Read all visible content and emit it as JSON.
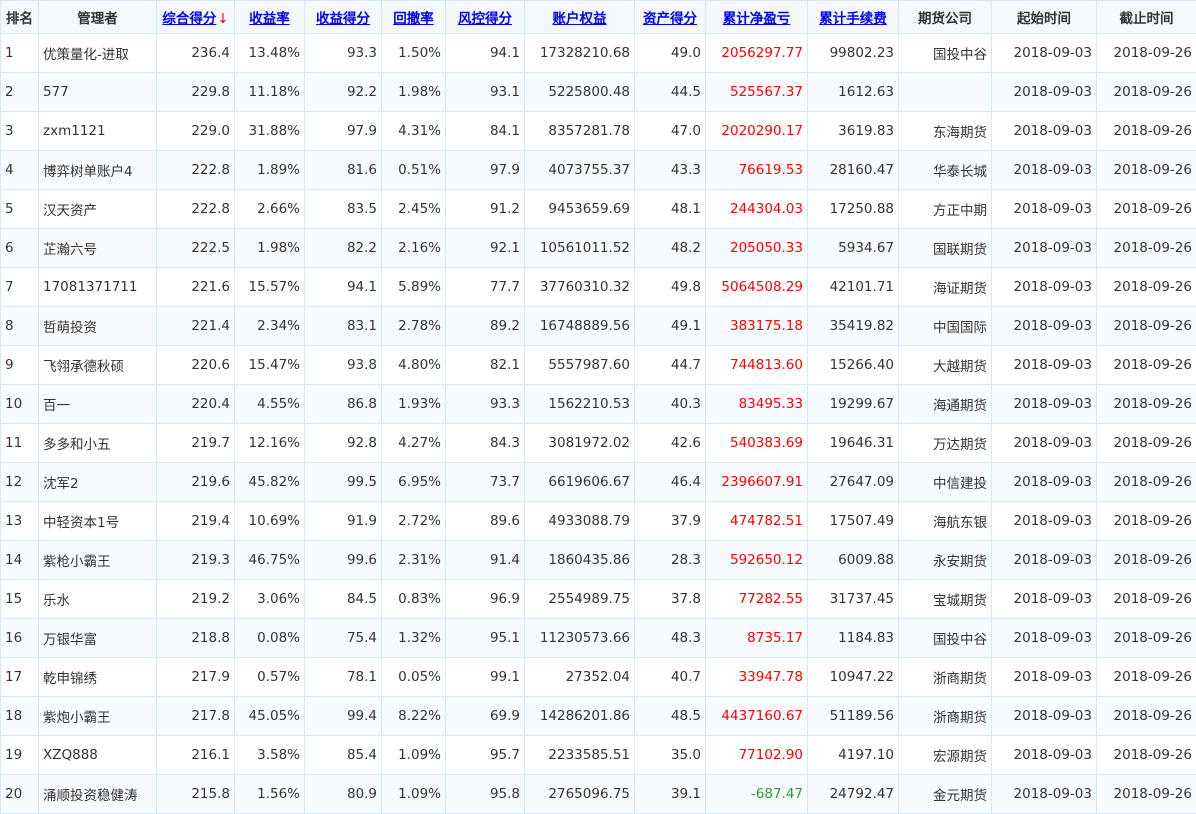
{
  "headers": [
    {
      "key": "rank",
      "label": "排名",
      "sortable": false
    },
    {
      "key": "manager",
      "label": "管理者",
      "sortable": false
    },
    {
      "key": "total_score",
      "label": "综合得分",
      "sortable": true,
      "sorted": "desc"
    },
    {
      "key": "return_rate",
      "label": "收益率",
      "sortable": true
    },
    {
      "key": "return_score",
      "label": "收益得分",
      "sortable": true
    },
    {
      "key": "drawdown",
      "label": "回撤率",
      "sortable": true
    },
    {
      "key": "risk_score",
      "label": "风控得分",
      "sortable": true
    },
    {
      "key": "equity",
      "label": "账户权益",
      "sortable": true
    },
    {
      "key": "asset_score",
      "label": "资产得分",
      "sortable": true
    },
    {
      "key": "net_pnl",
      "label": "累计净盈亏",
      "sortable": true
    },
    {
      "key": "fees",
      "label": "累计手续费",
      "sortable": true
    },
    {
      "key": "broker",
      "label": "期货公司",
      "sortable": false
    },
    {
      "key": "start",
      "label": "起始时间",
      "sortable": false
    },
    {
      "key": "end",
      "label": "截止时间",
      "sortable": false
    }
  ],
  "sort_arrow": "↓",
  "colors": {
    "profit": "#ff0000",
    "loss": "#339933",
    "link": "#0000ee",
    "border": "#d6e7f7"
  },
  "rows": [
    {
      "rank": "1",
      "manager": "优策量化-进取",
      "total_score": "236.4",
      "return_rate": "13.48%",
      "return_score": "93.3",
      "drawdown": "1.50%",
      "risk_score": "94.1",
      "equity": "17328210.68",
      "asset_score": "49.0",
      "net_pnl": "2056297.77",
      "fees": "99802.23",
      "broker": "国投中谷",
      "start": "2018-09-03",
      "end": "2018-09-26"
    },
    {
      "rank": "2",
      "manager": "577",
      "total_score": "229.8",
      "return_rate": "11.18%",
      "return_score": "92.2",
      "drawdown": "1.98%",
      "risk_score": "93.1",
      "equity": "5225800.48",
      "asset_score": "44.5",
      "net_pnl": "525567.37",
      "fees": "1612.63",
      "broker": "",
      "start": "2018-09-03",
      "end": "2018-09-26"
    },
    {
      "rank": "3",
      "manager": "zxm1121",
      "total_score": "229.0",
      "return_rate": "31.88%",
      "return_score": "97.9",
      "drawdown": "4.31%",
      "risk_score": "84.1",
      "equity": "8357281.78",
      "asset_score": "47.0",
      "net_pnl": "2020290.17",
      "fees": "3619.83",
      "broker": "东海期货",
      "start": "2018-09-03",
      "end": "2018-09-26"
    },
    {
      "rank": "4",
      "manager": "博弈树单账户4",
      "total_score": "222.8",
      "return_rate": "1.89%",
      "return_score": "81.6",
      "drawdown": "0.51%",
      "risk_score": "97.9",
      "equity": "4073755.37",
      "asset_score": "43.3",
      "net_pnl": "76619.53",
      "fees": "28160.47",
      "broker": "华泰长城",
      "start": "2018-09-03",
      "end": "2018-09-26"
    },
    {
      "rank": "5",
      "manager": "汉天资产",
      "total_score": "222.8",
      "return_rate": "2.66%",
      "return_score": "83.5",
      "drawdown": "2.45%",
      "risk_score": "91.2",
      "equity": "9453659.69",
      "asset_score": "48.1",
      "net_pnl": "244304.03",
      "fees": "17250.88",
      "broker": "方正中期",
      "start": "2018-09-03",
      "end": "2018-09-26"
    },
    {
      "rank": "6",
      "manager": "芷瀚六号",
      "total_score": "222.5",
      "return_rate": "1.98%",
      "return_score": "82.2",
      "drawdown": "2.16%",
      "risk_score": "92.1",
      "equity": "10561011.52",
      "asset_score": "48.2",
      "net_pnl": "205050.33",
      "fees": "5934.67",
      "broker": "国联期货",
      "start": "2018-09-03",
      "end": "2018-09-26"
    },
    {
      "rank": "7",
      "manager": "17081371711",
      "total_score": "221.6",
      "return_rate": "15.57%",
      "return_score": "94.1",
      "drawdown": "5.89%",
      "risk_score": "77.7",
      "equity": "37760310.32",
      "asset_score": "49.8",
      "net_pnl": "5064508.29",
      "fees": "42101.71",
      "broker": "海证期货",
      "start": "2018-09-03",
      "end": "2018-09-26"
    },
    {
      "rank": "8",
      "manager": "哲萌投资",
      "total_score": "221.4",
      "return_rate": "2.34%",
      "return_score": "83.1",
      "drawdown": "2.78%",
      "risk_score": "89.2",
      "equity": "16748889.56",
      "asset_score": "49.1",
      "net_pnl": "383175.18",
      "fees": "35419.82",
      "broker": "中国国际",
      "start": "2018-09-03",
      "end": "2018-09-26"
    },
    {
      "rank": "9",
      "manager": "飞翎承德秋硕",
      "total_score": "220.6",
      "return_rate": "15.47%",
      "return_score": "93.8",
      "drawdown": "4.80%",
      "risk_score": "82.1",
      "equity": "5557987.60",
      "asset_score": "44.7",
      "net_pnl": "744813.60",
      "fees": "15266.40",
      "broker": "大越期货",
      "start": "2018-09-03",
      "end": "2018-09-26"
    },
    {
      "rank": "10",
      "manager": "百一",
      "total_score": "220.4",
      "return_rate": "4.55%",
      "return_score": "86.8",
      "drawdown": "1.93%",
      "risk_score": "93.3",
      "equity": "1562210.53",
      "asset_score": "40.3",
      "net_pnl": "83495.33",
      "fees": "19299.67",
      "broker": "海通期货",
      "start": "2018-09-03",
      "end": "2018-09-26"
    },
    {
      "rank": "11",
      "manager": "多多和小五",
      "total_score": "219.7",
      "return_rate": "12.16%",
      "return_score": "92.8",
      "drawdown": "4.27%",
      "risk_score": "84.3",
      "equity": "3081972.02",
      "asset_score": "42.6",
      "net_pnl": "540383.69",
      "fees": "19646.31",
      "broker": "万达期货",
      "start": "2018-09-03",
      "end": "2018-09-26"
    },
    {
      "rank": "12",
      "manager": "沈军2",
      "total_score": "219.6",
      "return_rate": "45.82%",
      "return_score": "99.5",
      "drawdown": "6.95%",
      "risk_score": "73.7",
      "equity": "6619606.67",
      "asset_score": "46.4",
      "net_pnl": "2396607.91",
      "fees": "27647.09",
      "broker": "中信建投",
      "start": "2018-09-03",
      "end": "2018-09-26"
    },
    {
      "rank": "13",
      "manager": "中轻资本1号",
      "total_score": "219.4",
      "return_rate": "10.69%",
      "return_score": "91.9",
      "drawdown": "2.72%",
      "risk_score": "89.6",
      "equity": "4933088.79",
      "asset_score": "37.9",
      "net_pnl": "474782.51",
      "fees": "17507.49",
      "broker": "海航东银",
      "start": "2018-09-03",
      "end": "2018-09-26"
    },
    {
      "rank": "14",
      "manager": "紫枪小霸王",
      "total_score": "219.3",
      "return_rate": "46.75%",
      "return_score": "99.6",
      "drawdown": "2.31%",
      "risk_score": "91.4",
      "equity": "1860435.86",
      "asset_score": "28.3",
      "net_pnl": "592650.12",
      "fees": "6009.88",
      "broker": "永安期货",
      "start": "2018-09-03",
      "end": "2018-09-26"
    },
    {
      "rank": "15",
      "manager": "乐水",
      "total_score": "219.2",
      "return_rate": "3.06%",
      "return_score": "84.5",
      "drawdown": "0.83%",
      "risk_score": "96.9",
      "equity": "2554989.75",
      "asset_score": "37.8",
      "net_pnl": "77282.55",
      "fees": "31737.45",
      "broker": "宝城期货",
      "start": "2018-09-03",
      "end": "2018-09-26"
    },
    {
      "rank": "16",
      "manager": "万银华富",
      "total_score": "218.8",
      "return_rate": "0.08%",
      "return_score": "75.4",
      "drawdown": "1.32%",
      "risk_score": "95.1",
      "equity": "11230573.66",
      "asset_score": "48.3",
      "net_pnl": "8735.17",
      "fees": "1184.83",
      "broker": "国投中谷",
      "start": "2018-09-03",
      "end": "2018-09-26"
    },
    {
      "rank": "17",
      "manager": "乾申锦绣",
      "total_score": "217.9",
      "return_rate": "0.57%",
      "return_score": "78.1",
      "drawdown": "0.05%",
      "risk_score": "99.1",
      "equity": "27352.04",
      "asset_score": "40.7",
      "net_pnl": "33947.78",
      "fees": "10947.22",
      "broker": "浙商期货",
      "start": "2018-09-03",
      "end": "2018-09-26"
    },
    {
      "rank": "18",
      "manager": "紫炮小霸王",
      "total_score": "217.8",
      "return_rate": "45.05%",
      "return_score": "99.4",
      "drawdown": "8.22%",
      "risk_score": "69.9",
      "equity": "14286201.86",
      "asset_score": "48.5",
      "net_pnl": "4437160.67",
      "fees": "51189.56",
      "broker": "浙商期货",
      "start": "2018-09-03",
      "end": "2018-09-26"
    },
    {
      "rank": "19",
      "manager": "XZQ888",
      "total_score": "216.1",
      "return_rate": "3.58%",
      "return_score": "85.4",
      "drawdown": "1.09%",
      "risk_score": "95.7",
      "equity": "2233585.51",
      "asset_score": "35.0",
      "net_pnl": "77102.90",
      "fees": "4197.10",
      "broker": "宏源期货",
      "start": "2018-09-03",
      "end": "2018-09-26"
    },
    {
      "rank": "20",
      "manager": "涌顺投资稳健涛",
      "total_score": "215.8",
      "return_rate": "1.56%",
      "return_score": "80.9",
      "drawdown": "1.09%",
      "risk_score": "95.8",
      "equity": "2765096.75",
      "asset_score": "39.1",
      "net_pnl": "-687.47",
      "fees": "24792.47",
      "broker": "金元期货",
      "start": "2018-09-03",
      "end": "2018-09-26"
    }
  ]
}
